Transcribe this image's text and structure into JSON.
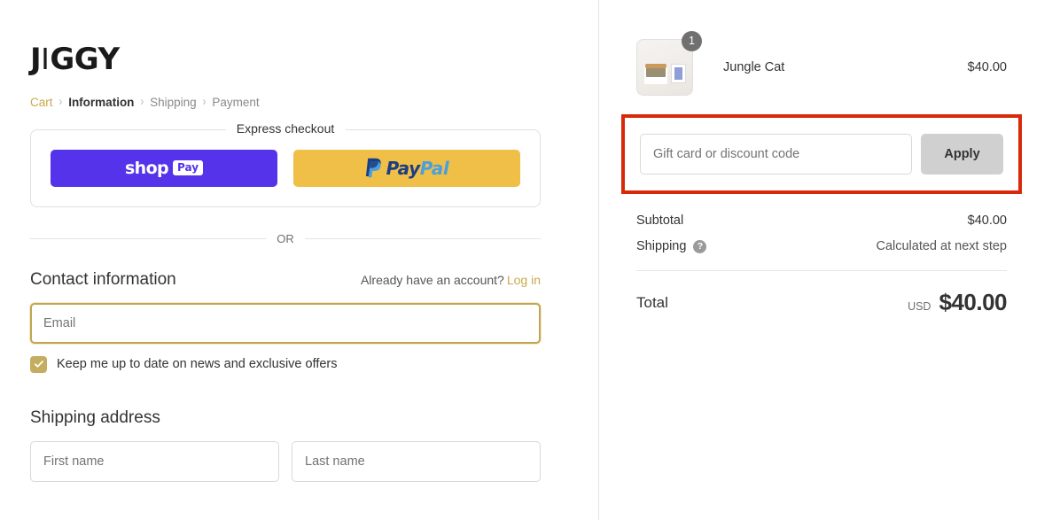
{
  "brand": {
    "logo_part1": "J",
    "logo_i": "I",
    "logo_part2": "GGY",
    "accent_color": "#c9a949",
    "annotation_color": "#d82a0a"
  },
  "breadcrumb": {
    "items": [
      {
        "label": "Cart",
        "state": "link"
      },
      {
        "label": "Information",
        "state": "current"
      },
      {
        "label": "Shipping",
        "state": "muted"
      },
      {
        "label": "Payment",
        "state": "muted"
      }
    ],
    "separator": "›"
  },
  "express": {
    "legend": "Express checkout",
    "shop_pay": {
      "word": "shop",
      "chip": "Pay",
      "color": "#5433eb"
    },
    "paypal": {
      "dark": "Pay",
      "light": "Pal",
      "color": "#efbf47"
    }
  },
  "divider": {
    "or_text": "OR"
  },
  "contact": {
    "title": "Contact information",
    "account_prompt": "Already have an account?",
    "login_label": "Log in",
    "email_placeholder": "Email",
    "email_value": "",
    "newsletter_label": "Keep me up to date on news and exclusive offers",
    "newsletter_checked": true
  },
  "shipping_address": {
    "title": "Shipping address",
    "first_name_placeholder": "First name",
    "first_name_value": "",
    "last_name_placeholder": "Last name",
    "last_name_value": ""
  },
  "order_summary": {
    "line_items": [
      {
        "name": "Jungle Cat",
        "price": "$40.00",
        "quantity": "1"
      }
    ],
    "discount": {
      "placeholder": "Gift card or discount code",
      "value": "",
      "apply_label": "Apply"
    },
    "totals": [
      {
        "label": "Subtotal",
        "value": "$40.00",
        "muted": false
      },
      {
        "label": "Shipping",
        "value": "Calculated at next step",
        "muted": true,
        "has_help": true
      }
    ],
    "grand_total": {
      "label": "Total",
      "currency": "USD",
      "amount": "$40.00"
    }
  }
}
